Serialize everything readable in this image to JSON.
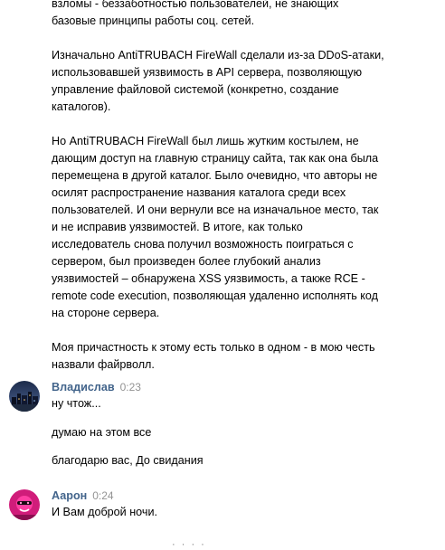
{
  "message_top": {
    "paragraphs": [
      "взломы - беззаботностью пользователей, не знающих\nбазовые принципы работы соц. сетей.",
      "Изначально AntiTRUBACH FireWall сделали из-за DDoS-атаки,\nиспользовавшей уязвимость в API сервера, позволяющую\nуправление файловой системой (конкретно, создание\nкаталогов).",
      "Но AntiTRUBACH FireWall был лишь жутким костылем, не\nдающим доступ на главную страницу сайта, так как она была\nперемещена в другой каталог. Было очевидно, что авторы не\nосилят распространение названия каталога среди всех\nпользователей. И они вернули все на изначальное место, так\nи не исправив уязвимостей. В итоге, как только\nисследователь снова получил возможность поиграться с\nсервером, был произведен более глубокий анализ\nуязвимостей – обнаружена XSS уязвимость, а также RCE -\nremote code execution, позволяющая удаленно исполнять код\nна стороне сервера.",
      "Моя причастность к этому есть только в одном - в мою честь\nназвали файрволл."
    ]
  },
  "messages": [
    {
      "author": "Владислав",
      "time": "0:23",
      "lines": [
        "ну чтож...",
        "думаю на этом все",
        "благодарю вас, До свидания"
      ]
    },
    {
      "author": "Аарон",
      "time": "0:24",
      "lines": [
        "И Вам доброй ночи."
      ]
    }
  ],
  "typing_indicator": "· · · ·",
  "colors": {
    "author": "#42648b",
    "time": "#939393"
  },
  "icons": {
    "avatar1": "city-night-avatar",
    "avatar2": "neon-face-avatar"
  }
}
